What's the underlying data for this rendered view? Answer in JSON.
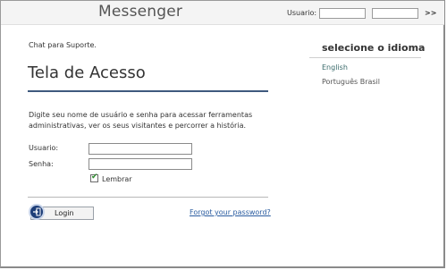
{
  "header": {
    "app_title": "Messenger",
    "user_label": "Usuario:",
    "username_value": "",
    "password_value": "",
    "go_label": ">>"
  },
  "main": {
    "subtitle": "Chat para Suporte.",
    "title": "Tela de Acesso",
    "description": "Digite seu nome de usuário e senha para acessar ferramentas administrativas, ver os seus visitantes e percorrer a história.",
    "username_label": "Usuario:",
    "password_label": "Senha:",
    "username_value": "",
    "password_value": "",
    "remember_label": "Lembrar",
    "remember_checked": true,
    "login_label": "Login",
    "forgot_label": "Forgot your password?"
  },
  "sidebar": {
    "heading": "selecione o idioma",
    "languages": [
      {
        "label": "English",
        "selected": true
      },
      {
        "label": "Português Brasil",
        "selected": false
      }
    ]
  },
  "icons": {
    "login": "login-arrow-icon",
    "remember": "checkmark-icon"
  },
  "colors": {
    "title_rule": "#3f5a7e",
    "link": "#2a5ca0",
    "selected_language": "#3a6b6b",
    "checkmark": "#2a8a2a"
  }
}
